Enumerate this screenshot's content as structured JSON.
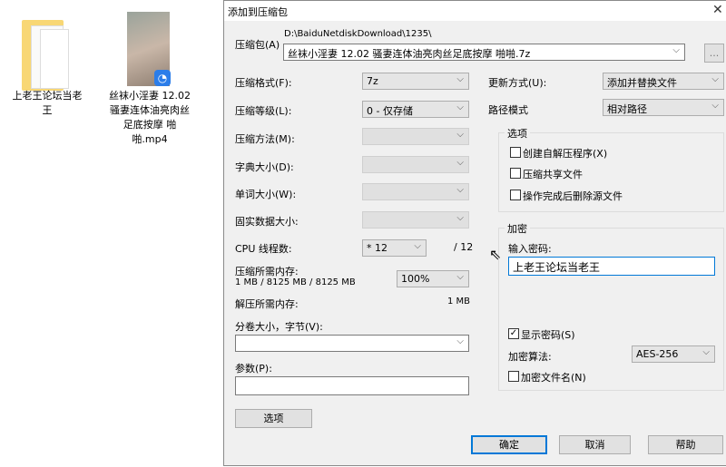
{
  "desktop": {
    "items": [
      {
        "label": "上老王论坛当老王",
        "icon": "folder-icon"
      },
      {
        "label": "丝袜小淫妻 12.02 骚妻连体油亮肉丝足底按摩 啪啪.mp4",
        "icon": "video-thumbnail"
      }
    ]
  },
  "dialog": {
    "title": "添加到压缩包",
    "archive_label": "压缩包(A)",
    "archive_path": "D:\\BaiduNetdiskDownload\\1235\\",
    "archive_name": "丝袜小淫妻 12.02 骚妻连体油亮肉丝足底按摩 啪啪.7z",
    "browse_label": "...",
    "format_label": "压缩格式(F):",
    "format_value": "7z",
    "level_label": "压缩等级(L):",
    "level_value": "0 - 仅存储",
    "method_label": "压缩方法(M):",
    "dict_label": "字典大小(D):",
    "word_label": "单词大小(W):",
    "solid_label": "固实数据大小:",
    "cpu_label": "CPU 线程数:",
    "cpu_value": "* 12",
    "cpu_max": "/ 12",
    "mem_comp_label": "压缩所需内存:",
    "mem_comp_value": "1 MB / 8125 MB / 8125 MB",
    "mem_percent": "100%",
    "mem_decomp_label": "解压所需内存:",
    "mem_decomp_value": "1 MB",
    "split_label": "分卷大小，字节(V):",
    "split_value": "",
    "params_label": "参数(P):",
    "params_value": "",
    "options_button": "选项",
    "update_label": "更新方式(U):",
    "update_value": "添加并替换文件",
    "path_mode_label": "路径模式",
    "path_mode_value": "相对路径",
    "options_group": "选项",
    "opt_sfx": "创建自解压程序(X)",
    "opt_shared": "压缩共享文件",
    "opt_delete": "操作完成后删除源文件",
    "enc_group": "加密",
    "password_label": "输入密码:",
    "password_value": "上老王论坛当老王",
    "show_password": "显示密码(S)",
    "enc_method_label": "加密算法:",
    "enc_method_value": "AES-256",
    "encrypt_names": "加密文件名(N)",
    "ok": "确定",
    "cancel": "取消",
    "help": "帮助"
  }
}
